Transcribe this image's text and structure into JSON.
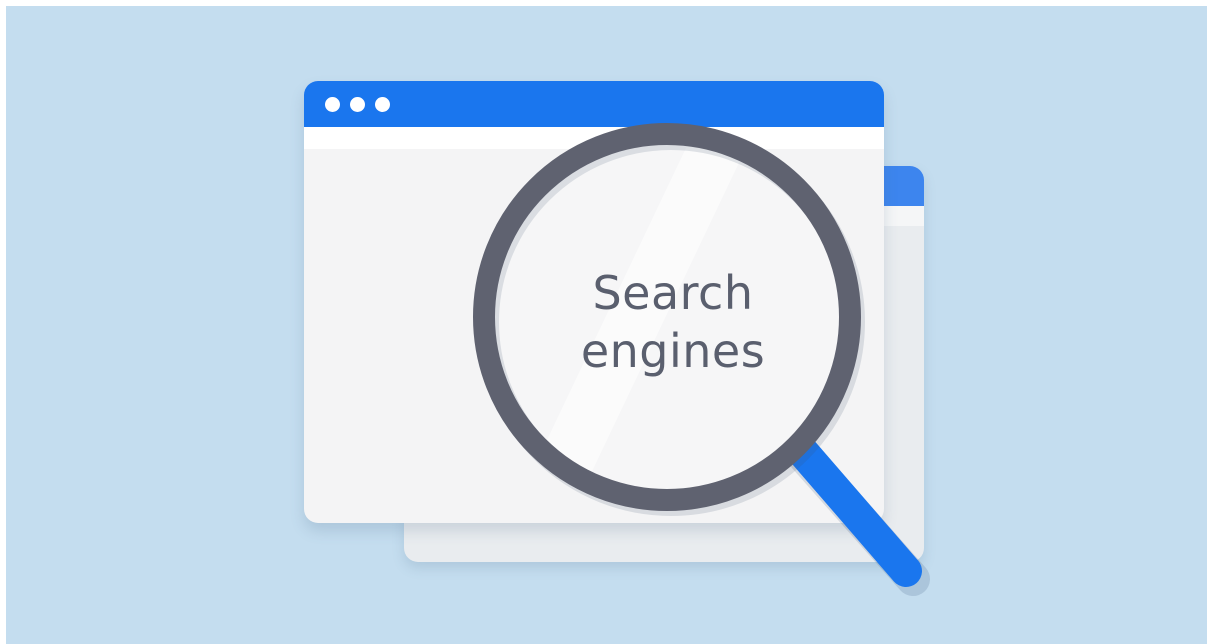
{
  "illustration": {
    "lens_text_line1": "Search",
    "lens_text_line2": "engines"
  },
  "icons": {
    "magnifier": "magnifying-glass-icon",
    "window_dots": "window-control-dots-icon"
  },
  "colors": {
    "background": "#c4ddef",
    "front_bar": "#1a76ee",
    "back_bar": "#3d85ee",
    "lens_ring": "#5f6270",
    "handle": "#1a76ee"
  }
}
